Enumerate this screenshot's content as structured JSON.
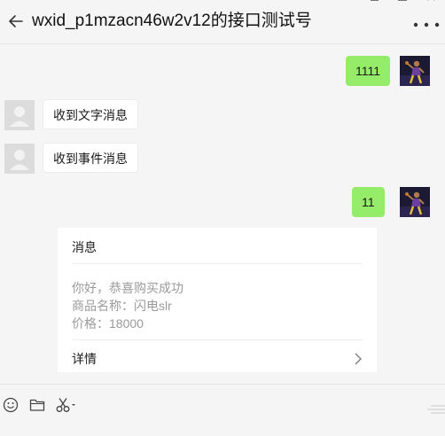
{
  "header": {
    "title": "wxid_p1mzacn46w2v12的接口测试号",
    "back_icon": "arrow-left-icon",
    "more_icon": "more-dots-icon",
    "window_controls": [
      "minimize-icon",
      "maximize-icon",
      "close-icon"
    ]
  },
  "messages": [
    {
      "direction": "outgoing",
      "text": "1111"
    },
    {
      "direction": "incoming",
      "text": "收到文字消息"
    },
    {
      "direction": "incoming",
      "text": "收到事件消息"
    },
    {
      "direction": "outgoing",
      "text": "11"
    }
  ],
  "card": {
    "title": "消息",
    "lines": [
      "你好，恭喜购买成功",
      "商品名称：闪电slr",
      "价格：18000"
    ],
    "detail_label": "详情"
  },
  "toolbar": {
    "icons": [
      "emoji-icon",
      "folder-icon",
      "scissors-icon"
    ]
  },
  "colors": {
    "background": "#f5f5f5",
    "outgoing_bubble": "#95ec69",
    "incoming_bubble": "#ffffff",
    "card_text_muted": "#9a9a9a"
  }
}
